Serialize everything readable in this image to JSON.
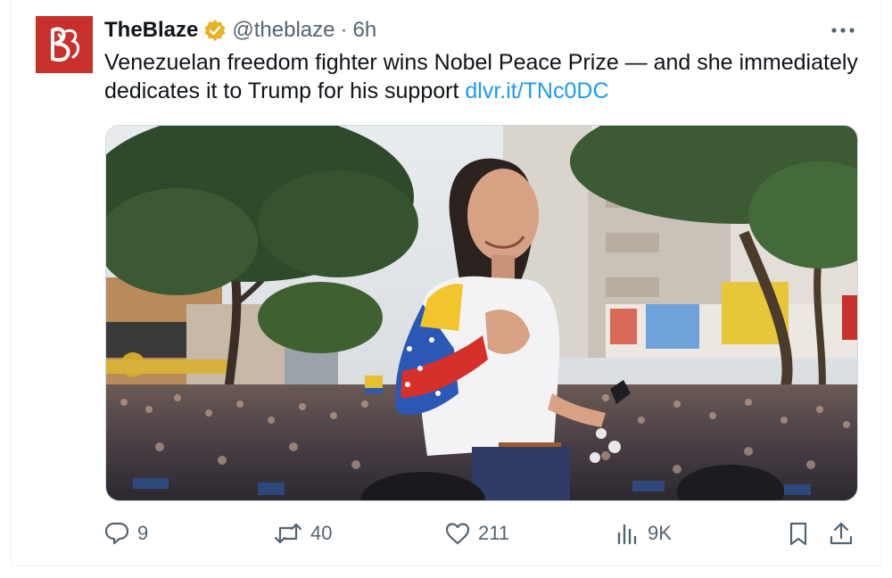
{
  "tweet": {
    "display_name": "TheBlaze",
    "handle": "@theblaze",
    "separator": "·",
    "time": "6h",
    "text": "Venezuelan freedom fighter wins Nobel Peace Prize — and she immediately dedicates it to Trump for his support ",
    "link_text": "dlvr.it/TNc0DC",
    "verified_badge_color": "#e6b325",
    "brand_color": "#c8312b",
    "link_color": "#1d9bf0"
  },
  "stats": {
    "replies": "9",
    "reposts": "40",
    "likes": "211",
    "views": "9K"
  },
  "icons": {
    "reply": "speech-bubble-icon",
    "repost": "repost-arrows-icon",
    "like": "heart-icon",
    "views": "bar-chart-icon",
    "bookmark": "bookmark-icon",
    "share": "share-upload-icon",
    "more": "ellipsis-icon",
    "verified": "verified-badge-icon"
  }
}
